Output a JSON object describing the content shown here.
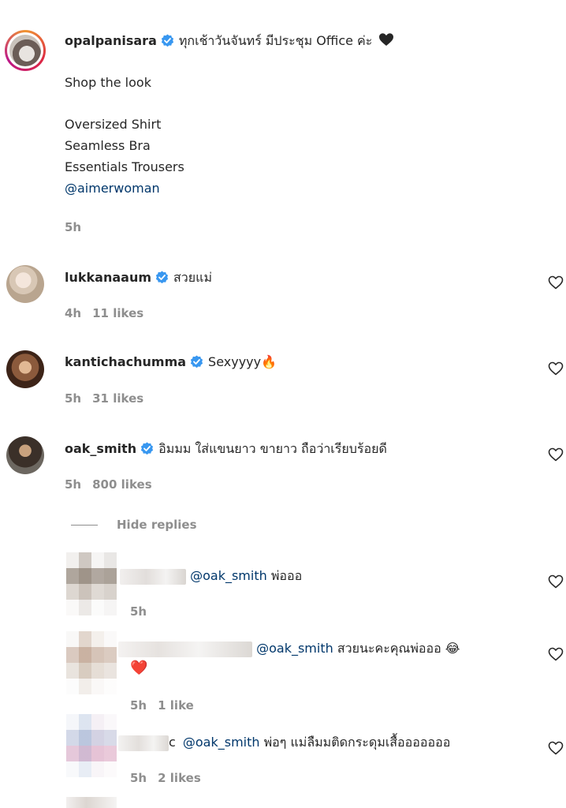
{
  "post": {
    "username": "opalpanisara",
    "caption_first": "ทุกเช้าวันจันทร์ มีประชุม Office ค่ะ",
    "shop_line": "Shop the look",
    "items": [
      "Oversized Shirt",
      "Seamless Bra",
      "Essentials Trousers"
    ],
    "mention": "@aimerwoman",
    "time": "5h"
  },
  "comments": [
    {
      "username": "lukkanaaum",
      "text": "สวยแม่",
      "time": "4h",
      "likes": "11 likes"
    },
    {
      "username": "kantichachumma",
      "text": "Sexyyyy",
      "emoji": "🔥",
      "time": "5h",
      "likes": "31 likes"
    },
    {
      "username": "oak_smith",
      "text": "อิมมม ใส่แขนยาว ขายาว ถือว่าเรียบร้อยดี",
      "time": "5h",
      "likes": "800 likes"
    }
  ],
  "hide_replies_label": "Hide replies",
  "replies": [
    {
      "mention": "@oak_smith",
      "text": "พ่อออ",
      "time": "5h",
      "likes": ""
    },
    {
      "mention": "@oak_smith",
      "text": "สวยนะคะคุณพ่อออ",
      "emoji": "😂",
      "emoji2": "❤️",
      "time": "5h",
      "likes": "1 like"
    },
    {
      "mention": "@oak_smith",
      "prefix": "c",
      "text": "พ่อๆ แม่ลืมมติดกระดุมเสื้อออออออ",
      "time": "5h",
      "likes": "2 likes"
    }
  ],
  "colors": {
    "verified": "#3897f0",
    "mention": "#00376b",
    "meta": "#8e8e8e"
  }
}
